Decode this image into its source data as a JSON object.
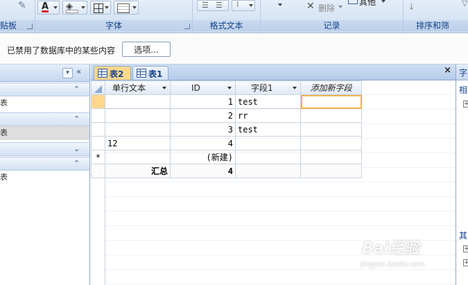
{
  "ribbon": {
    "groups": {
      "clipboard": "贴板",
      "font": "字体",
      "rich_text": "格式文本",
      "records": "记录",
      "sort_filter": "排序和筛"
    },
    "delete_label": "删除",
    "other_label": "其他"
  },
  "message_bar": {
    "text": "已禁用了数据库中的某些内容",
    "options_button": "选项..."
  },
  "nav_pane": {
    "items": [
      "表",
      "表",
      "表"
    ]
  },
  "tabs": [
    {
      "label": "表2",
      "active": true
    },
    {
      "label": "表1",
      "active": false
    }
  ],
  "close_glyph": "×",
  "datasheet": {
    "columns": [
      "单行文本",
      "ID",
      "字段1",
      "添加新字段"
    ],
    "rows": [
      {
        "text": "",
        "id": "1",
        "field1": "test"
      },
      {
        "text": "",
        "id": "2",
        "field1": "rr"
      },
      {
        "text": "",
        "id": "3",
        "field1": "test"
      },
      {
        "text": "12",
        "id": "4",
        "field1": ""
      }
    ],
    "new_row": {
      "marker": "*",
      "id": "(新建)"
    },
    "total_row": {
      "label": "汇总",
      "value": "4"
    }
  },
  "right_pane": {
    "header": "字",
    "section1": "相",
    "section2": "其"
  },
  "watermark": {
    "logo": "Bai经验",
    "url": "jingyan.baidu.com"
  },
  "colors": {
    "ribbon_text": "#15428b",
    "active_tab": "#ffd78c",
    "add_field_header": "#f6d58a"
  }
}
